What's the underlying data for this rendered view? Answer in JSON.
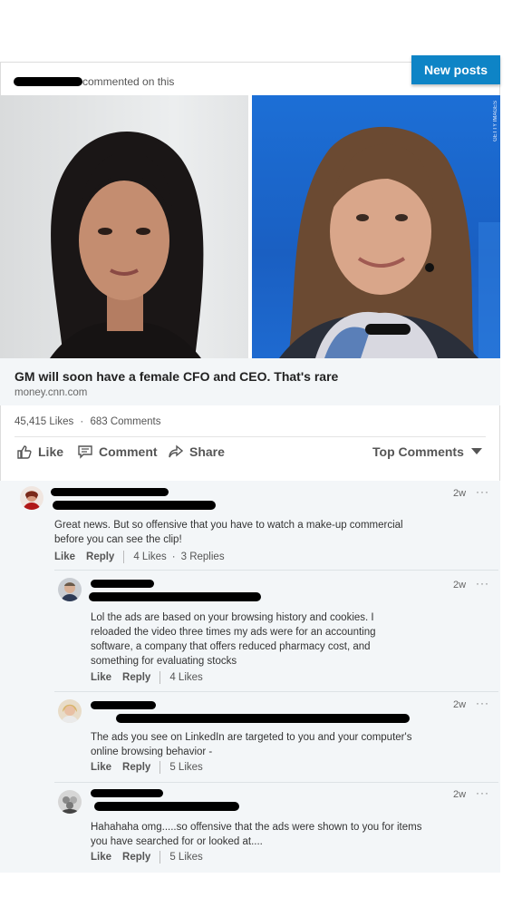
{
  "activity": {
    "text": "commented on this"
  },
  "new_posts_label": "New posts",
  "top_menu": "···",
  "photo_credit": "GETTY IMAGES",
  "article": {
    "title": "GM will soon have a female CFO and CEO. That's rare",
    "source": "money.cnn.com"
  },
  "stats": {
    "likes": "45,415 Likes",
    "separator": "·",
    "comments": "683 Comments"
  },
  "actions": {
    "like": "Like",
    "comment": "Comment",
    "share": "Share",
    "sort": "Top Comments"
  },
  "comments": [
    {
      "time": "2w",
      "menu": "···",
      "text": "Great news. But so offensive that you have to watch a make-up commercial before you can see the clip!",
      "like": "Like",
      "reply": "Reply",
      "likes": "4 Likes",
      "dot": "·",
      "replies": "3 Replies"
    },
    {
      "time": "2w",
      "menu": "···",
      "text": "Lol the ads are based on your browsing history and cookies. I reloaded the video three times my ads were for an accounting software, a company that offers reduced pharmacy cost, and something for evaluating stocks",
      "like": "Like",
      "reply": "Reply",
      "likes": "4 Likes"
    },
    {
      "time": "2w",
      "menu": "···",
      "text": "The ads you see on LinkedIn are targeted to you and your computer's online browsing behavior -",
      "like": "Like",
      "reply": "Reply",
      "likes": "5 Likes"
    },
    {
      "time": "2w",
      "menu": "···",
      "text": "Hahahaha omg.....so offensive that the ads were shown to you for items you have searched for or looked at....",
      "like": "Like",
      "reply": "Reply",
      "likes": "5 Likes"
    }
  ],
  "colors": {
    "accent": "#0e84c6",
    "panel": "#f3f6f8"
  }
}
